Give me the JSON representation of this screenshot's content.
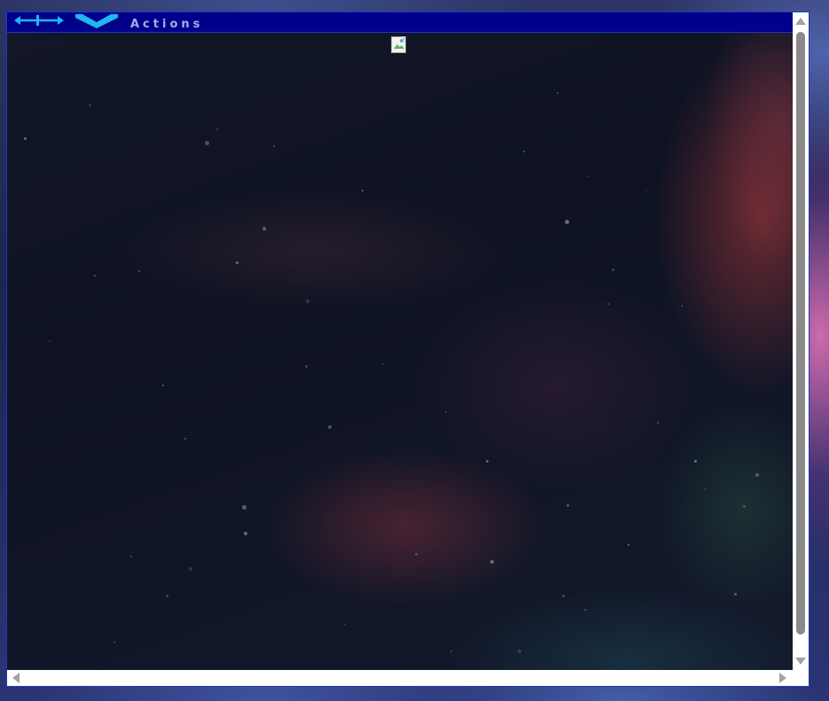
{
  "panel": {
    "title": "Actions",
    "icons": {
      "resize": "horizontal-resize-icon",
      "collapse": "chevron-down-icon"
    },
    "content_image": "broken-image-icon"
  },
  "colors": {
    "titlebar_bg": "#00008b",
    "title_text": "#9ab0ee",
    "icon_accent": "#1fb7f0",
    "scrollbar_thumb": "#8a8a8a",
    "scroll_arrow": "#a3a3a3",
    "frame_border": "#1a3bbf"
  }
}
